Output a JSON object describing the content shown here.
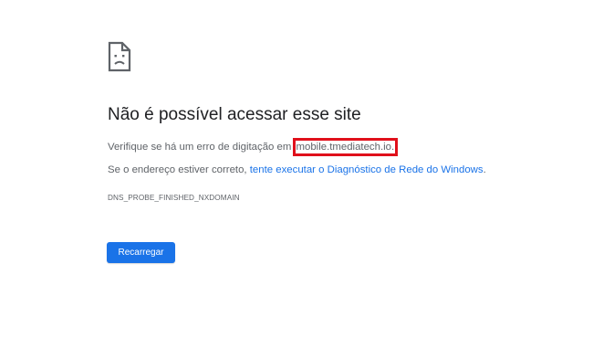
{
  "error_page": {
    "icon": "sad-page-icon",
    "title": "Não é possível acessar esse site",
    "check_text_prefix": "Verifique se há um erro de digitação em ",
    "hostname": "mobile.tmediatech.io.",
    "correct_prefix": "Se o endereço estiver correto, ",
    "diagnostics_link": "tente executar o Diagnóstico de Rede do Windows",
    "correct_suffix": ".",
    "error_code": "DNS_PROBE_FINISHED_NXDOMAIN",
    "reload_label": "Recarregar"
  },
  "colors": {
    "title": "#202124",
    "body_text": "#5f6368",
    "link": "#1a73e8",
    "button": "#1a73e8",
    "highlight_box": "#e0101b"
  }
}
